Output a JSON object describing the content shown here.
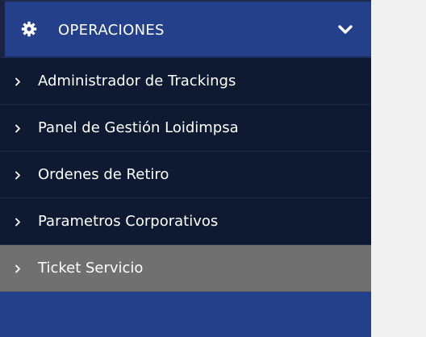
{
  "colors": {
    "header_bg": "#25408a",
    "menu_bg": "#0d1a32",
    "active_bg": "#707070",
    "text": "#ffffff",
    "content_bg": "#f1f1f2"
  },
  "section": {
    "icon": "gear-icon",
    "title": "OPERACIONES",
    "toggle_icon": "chevron-down-icon"
  },
  "menu": {
    "items": [
      {
        "label": "Administrador de Trackings",
        "icon": "chevron-right-icon",
        "active": false
      },
      {
        "label": "Panel de Gestión Loidimpsa",
        "icon": "chevron-right-icon",
        "active": false
      },
      {
        "label": "Ordenes de Retiro",
        "icon": "chevron-right-icon",
        "active": false
      },
      {
        "label": "Parametros Corporativos",
        "icon": "chevron-right-icon",
        "active": false
      },
      {
        "label": "Ticket Servicio",
        "icon": "chevron-right-icon",
        "active": true
      }
    ]
  }
}
